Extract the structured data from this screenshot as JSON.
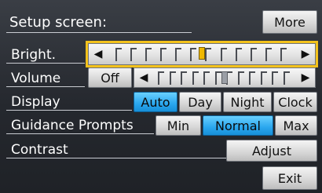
{
  "title": "Setup screen:",
  "more_label": "More",
  "rows": {
    "bright": {
      "label": "Bright.",
      "level": 0.5
    },
    "volume": {
      "label": "Volume",
      "off_label": "Off",
      "level": 0.5
    },
    "display": {
      "label": "Display",
      "options": [
        "Auto",
        "Day",
        "Night",
        "Clock"
      ],
      "selected": "Auto"
    },
    "guidance": {
      "label": "Guidance Prompts",
      "options": [
        "Min",
        "Normal",
        "Max"
      ],
      "selected": "Normal"
    },
    "contrast": {
      "label": "Contrast",
      "adjust_label": "Adjust"
    }
  },
  "exit_label": "Exit",
  "colors": {
    "selected": "#2aa6ee",
    "focus": "#f3c21c",
    "indicator": "#f0b800"
  },
  "icons": {
    "left": "left-arrow-icon",
    "right": "right-arrow-icon"
  }
}
